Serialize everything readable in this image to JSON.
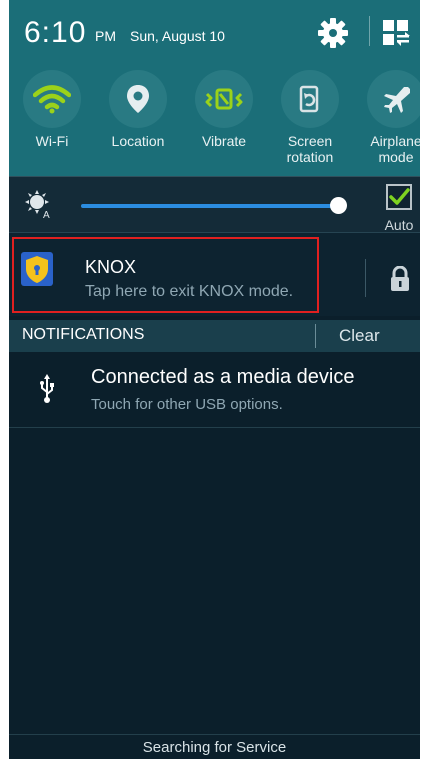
{
  "status": {
    "time": "6:10",
    "ampm": "PM",
    "date": "Sun, August 10",
    "settings_icon": "gear-icon",
    "grid_icon": "grid-edit-icon"
  },
  "quick_toggles": [
    {
      "label": "Wi-Fi",
      "icon": "wifi-icon",
      "active": true
    },
    {
      "label": "Location",
      "icon": "location-pin-icon",
      "active": false
    },
    {
      "label": "Vibrate",
      "icon": "vibrate-icon",
      "active": true
    },
    {
      "label": "Screen rotation",
      "icon": "screen-rotation-icon",
      "active": false
    },
    {
      "label": "Airplane mode",
      "icon": "airplane-icon",
      "active": false
    }
  ],
  "brightness": {
    "icon": "brightness-auto-icon",
    "level": 0.97,
    "auto_label": "Auto",
    "auto_checked": true
  },
  "knox": {
    "title": "KNOX",
    "description": "Tap here to exit KNOX mode.",
    "icon": "knox-shield-icon",
    "lock_icon": "lock-icon"
  },
  "notifications_header": {
    "title": "NOTIFICATIONS",
    "clear_label": "Clear"
  },
  "notifications": [
    {
      "icon": "usb-icon",
      "title": "Connected as a media device",
      "subtitle": "Touch for other USB options."
    }
  ],
  "footer": {
    "text": "Searching for Service"
  },
  "colors": {
    "panel_teal": "#1b6e78",
    "background": "#0b1f2b",
    "active_green": "#9bd21a",
    "slider_blue": "#2b8de0",
    "highlight_red": "#e02020"
  }
}
